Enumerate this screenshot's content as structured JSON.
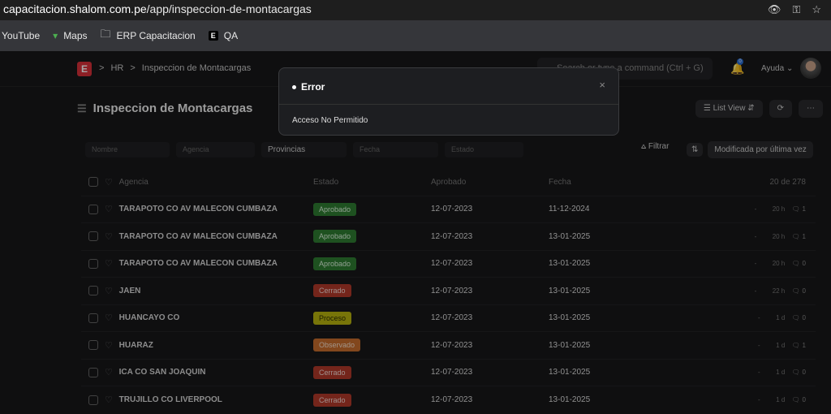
{
  "browser": {
    "url_host": "capacitacion.shalom.com.pe",
    "url_path": "/app/inspeccion-de-montacargas",
    "bookmarks": [
      {
        "label": "YouTube",
        "icon": "youtube-icon"
      },
      {
        "label": "Maps",
        "icon": "maps-pin-icon"
      },
      {
        "label": "ERP Capacitacion",
        "icon": "folder-icon"
      },
      {
        "label": "QA",
        "icon": "erp-logo-icon"
      }
    ]
  },
  "topnav": {
    "logo_letter": "E",
    "crumb_sep": ">",
    "crumb_1": "HR",
    "crumb_2": "Inspeccion de Montacargas",
    "search_placeholder": "Search or type a command (Ctrl + G)",
    "notif_count": "0",
    "help": "Ayuda"
  },
  "page": {
    "title": "Inspeccion de Montacargas",
    "list_view": "List View"
  },
  "filters": {
    "nombre": "Nombre",
    "agencia": "Agencia",
    "provincias": "Provincias",
    "fecha": "Fecha",
    "estado": "Estado",
    "filtrar": "Filtrar",
    "sort": "Modificada por última vez"
  },
  "table": {
    "headers": {
      "agencia": "Agencia",
      "estado": "Estado",
      "aprobado": "Aprobado",
      "fecha": "Fecha",
      "count": "20 de 278"
    },
    "rows": [
      {
        "agencia": "TARAPOTO CO AV MALECON CUMBAZA",
        "estado": "Aprobado",
        "color": "green",
        "aprobado": "12-07-2023",
        "fecha": "11-12-2024",
        "dash": "-",
        "time": "20 h",
        "comments": "1"
      },
      {
        "agencia": "TARAPOTO CO AV MALECON CUMBAZA",
        "estado": "Aprobado",
        "color": "green",
        "aprobado": "12-07-2023",
        "fecha": "13-01-2025",
        "dash": "-",
        "time": "20 h",
        "comments": "1"
      },
      {
        "agencia": "TARAPOTO CO AV MALECON CUMBAZA",
        "estado": "Aprobado",
        "color": "green",
        "aprobado": "12-07-2023",
        "fecha": "13-01-2025",
        "dash": "-",
        "time": "20 h",
        "comments": "0"
      },
      {
        "agencia": "JAEN",
        "estado": "Cerrado",
        "color": "red",
        "aprobado": "12-07-2023",
        "fecha": "13-01-2025",
        "dash": "-",
        "time": "22 h",
        "comments": "0"
      },
      {
        "agencia": "HUANCAYO CO",
        "estado": "Proceso",
        "color": "yellow",
        "aprobado": "12-07-2023",
        "fecha": "13-01-2025",
        "dash": "-",
        "time": "1 d",
        "comments": "0"
      },
      {
        "agencia": "HUARAZ",
        "estado": "Observado",
        "color": "orange",
        "aprobado": "12-07-2023",
        "fecha": "13-01-2025",
        "dash": "-",
        "time": "1 d",
        "comments": "1"
      },
      {
        "agencia": "ICA CO SAN JOAQUIN",
        "estado": "Cerrado",
        "color": "red",
        "aprobado": "12-07-2023",
        "fecha": "13-01-2025",
        "dash": "-",
        "time": "1 d",
        "comments": "0"
      },
      {
        "agencia": "TRUJILLO CO LIVERPOOL",
        "estado": "Cerrado",
        "color": "red",
        "aprobado": "12-07-2023",
        "fecha": "13-01-2025",
        "dash": "-",
        "time": "1 d",
        "comments": "0"
      }
    ]
  },
  "modal": {
    "title": "Error",
    "message": "Acceso No Permitido",
    "close": "×"
  }
}
